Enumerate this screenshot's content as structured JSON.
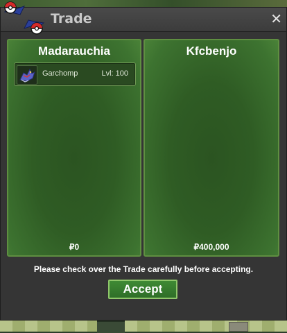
{
  "window": {
    "title": "Trade",
    "close_glyph": "✕"
  },
  "left_panel": {
    "player_name": "Madarauchia",
    "offered_pokemon": [
      {
        "name": "Garchomp",
        "level_text": "Lvl: 100",
        "icon": "garchomp-sprite-icon"
      }
    ],
    "money_symbol": "₽",
    "money_amount": "0"
  },
  "right_panel": {
    "player_name": "Kfcbenjo",
    "offered_pokemon": [],
    "money_symbol": "₽",
    "money_amount": "400,000"
  },
  "notice_text": "Please check over the Trade carefully before accepting.",
  "accept_label": "Accept",
  "colors": {
    "panel_border": "#5f8f41",
    "panel_fill": "#2f5c24",
    "window_bg": "#353535",
    "button_green": "#2f6e28"
  }
}
